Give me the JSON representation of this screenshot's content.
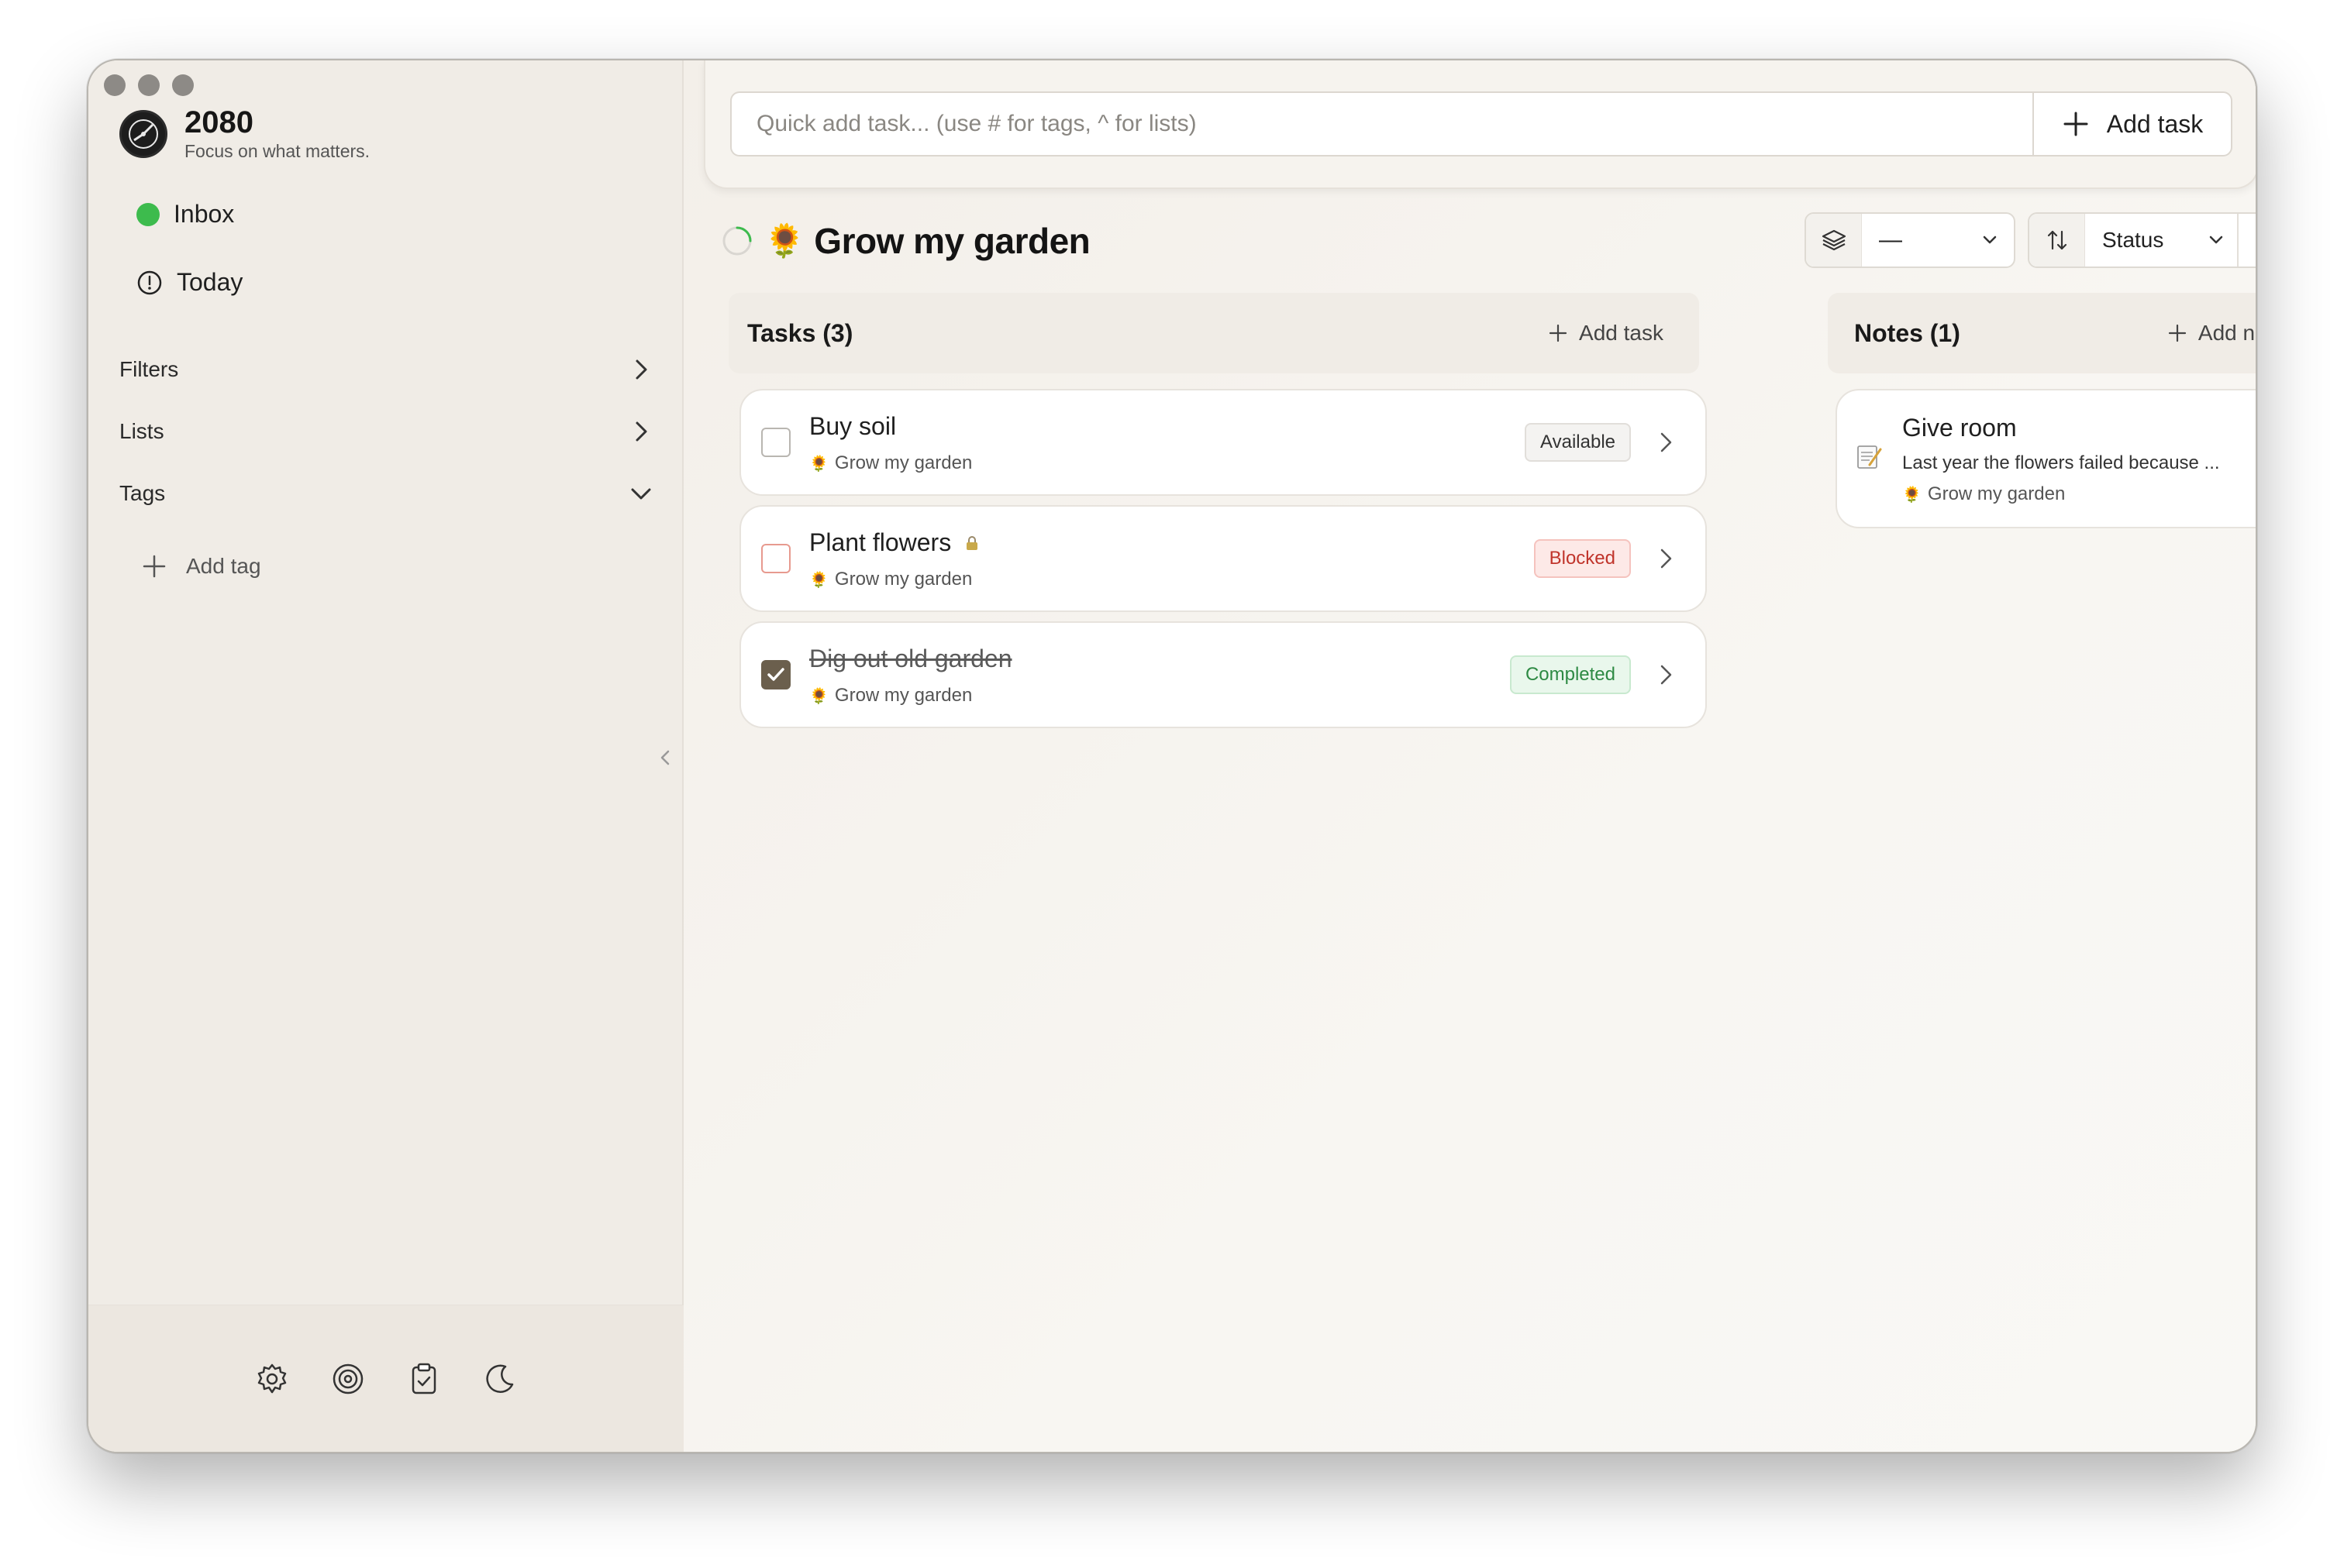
{
  "app": {
    "name": "2080",
    "tagline": "Focus on what matters."
  },
  "sidebar": {
    "nav": [
      {
        "label": "Inbox",
        "icon": "green-dot-icon"
      },
      {
        "label": "Today",
        "icon": "clock-alert-icon"
      }
    ],
    "sections": [
      {
        "label": "Filters",
        "state": "collapsed"
      },
      {
        "label": "Lists",
        "state": "collapsed"
      },
      {
        "label": "Tags",
        "state": "expanded"
      }
    ],
    "add_tag_label": "Add tag",
    "footer_icons": [
      "settings-icon",
      "target-icon",
      "clipboard-check-icon",
      "moon-icon"
    ]
  },
  "quick_add": {
    "placeholder": "Quick add task... (use # for tags, ^ for lists)",
    "button_label": "Add task"
  },
  "page": {
    "emoji": "🌻",
    "title": "Grow my garden"
  },
  "controls": {
    "group_value": "—",
    "sort_value": "Status"
  },
  "tasks": {
    "header": "Tasks (3)",
    "add_label": "Add task",
    "items": [
      {
        "title": "Buy soil",
        "list": "Grow my garden",
        "status": "Available",
        "checked": false
      },
      {
        "title": "Plant flowers",
        "list": "Grow my garden",
        "status": "Blocked",
        "checked": false,
        "locked": true
      },
      {
        "title": "Dig out old garden",
        "list": "Grow my garden",
        "status": "Completed",
        "checked": true
      }
    ]
  },
  "notes": {
    "header": "Notes (1)",
    "add_label": "Add note",
    "items": [
      {
        "title": "Give room",
        "snippet": "Last year the flowers failed because ...",
        "list": "Grow my garden"
      }
    ]
  },
  "colors": {
    "accent_green": "#3dbb4d",
    "blocked_red": "#c0342b",
    "completed_green": "#2e8a44",
    "checkbox_done": "#6b5f4d"
  }
}
